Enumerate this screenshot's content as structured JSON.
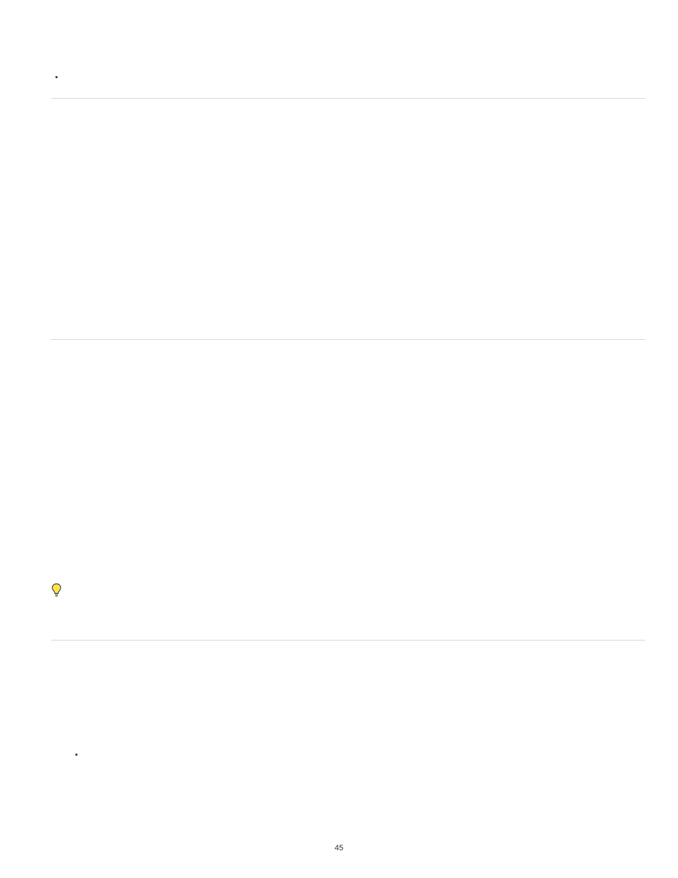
{
  "top_bullets": [
    "",
    ""
  ],
  "bottom_bullets": [
    "",
    ""
  ],
  "page_number": "45"
}
